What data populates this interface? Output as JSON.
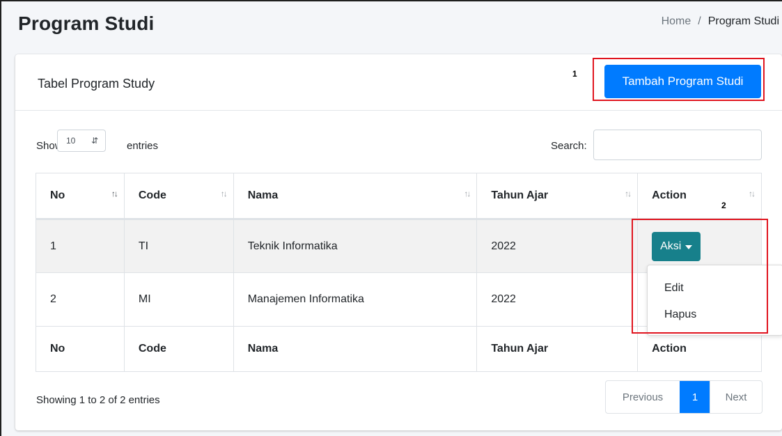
{
  "page": {
    "title": "Program Studi"
  },
  "breadcrumb": {
    "home": "Home",
    "separator": "/",
    "current": "Program Studi"
  },
  "card": {
    "title": "Tabel Program Study",
    "add_button": "Tambah Program Studi"
  },
  "annotations": {
    "first": "1",
    "second": "2"
  },
  "length_menu": {
    "prefix": "Show",
    "value": "10",
    "suffix": "entries"
  },
  "search": {
    "label": "Search:",
    "value": ""
  },
  "table": {
    "columns": [
      "No",
      "Code",
      "Nama",
      "Tahun Ajar",
      "Action"
    ],
    "rows": [
      {
        "no": "1",
        "code": "TI",
        "nama": "Teknik Informatika",
        "tahun": "2022"
      },
      {
        "no": "2",
        "code": "MI",
        "nama": "Manajemen Informatika",
        "tahun": "2022"
      }
    ],
    "footer": [
      "No",
      "Code",
      "Nama",
      "Tahun Ajar",
      "Action"
    ]
  },
  "action": {
    "button_label": "Aksi",
    "menu_items": [
      "Edit",
      "Hapus"
    ]
  },
  "info": "Showing 1 to 2 of 2 entries",
  "pagination": {
    "previous": "Previous",
    "current_page": "1",
    "next": "Next"
  },
  "colors": {
    "primary": "#007bff",
    "aksi": "#17808b",
    "annotation": "#e0141e"
  }
}
